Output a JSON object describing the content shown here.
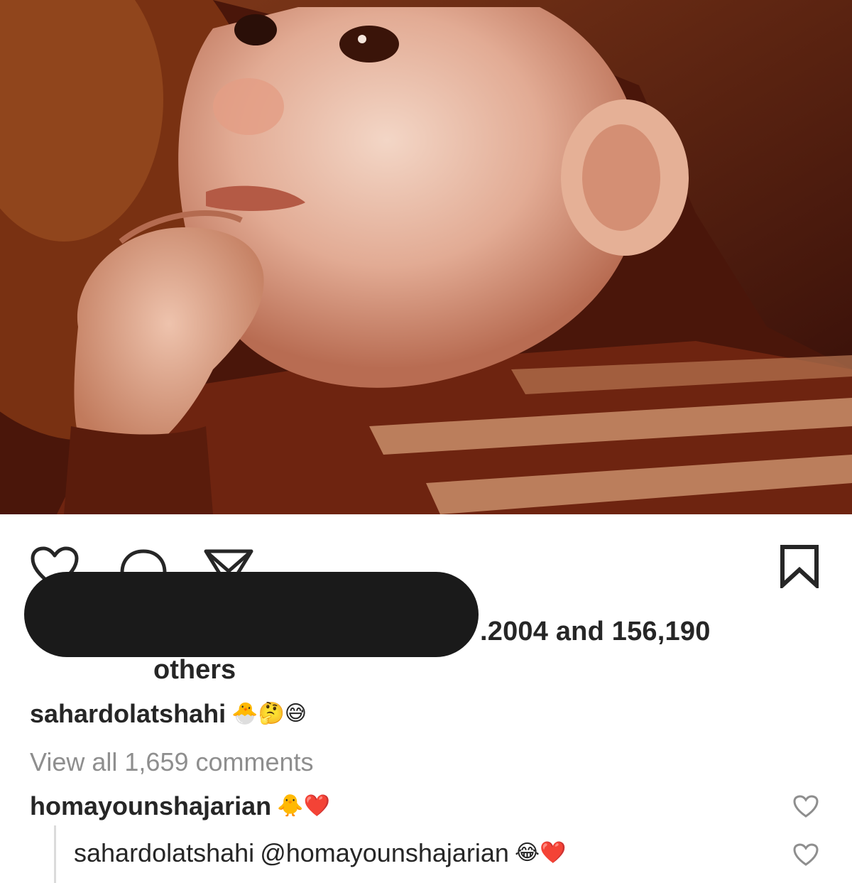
{
  "post": {
    "likes_text": ".2004 and 156,190",
    "likes_others": "others"
  },
  "caption": {
    "username": "sahardolatshahi",
    "emojis": "🐣🤔😅"
  },
  "view_all_comments": "View all 1,659 comments",
  "comments": [
    {
      "username": "homayounshajarian",
      "text": "",
      "emojis": "🐥❤️"
    }
  ],
  "reply": {
    "username": "sahardolatshahi",
    "mention": "@homayounshajarian",
    "emojis": "😂❤️"
  },
  "icons": {
    "like": "heart-outline-icon",
    "comment": "comment-bubble-icon",
    "share": "paper-plane-icon",
    "save": "bookmark-icon",
    "comment_like": "heart-outline-icon"
  },
  "colors": {
    "text": "#262626",
    "muted": "#8e8e8e",
    "redaction": "#1a1a1a",
    "photo_tone": "#6b2a12"
  }
}
